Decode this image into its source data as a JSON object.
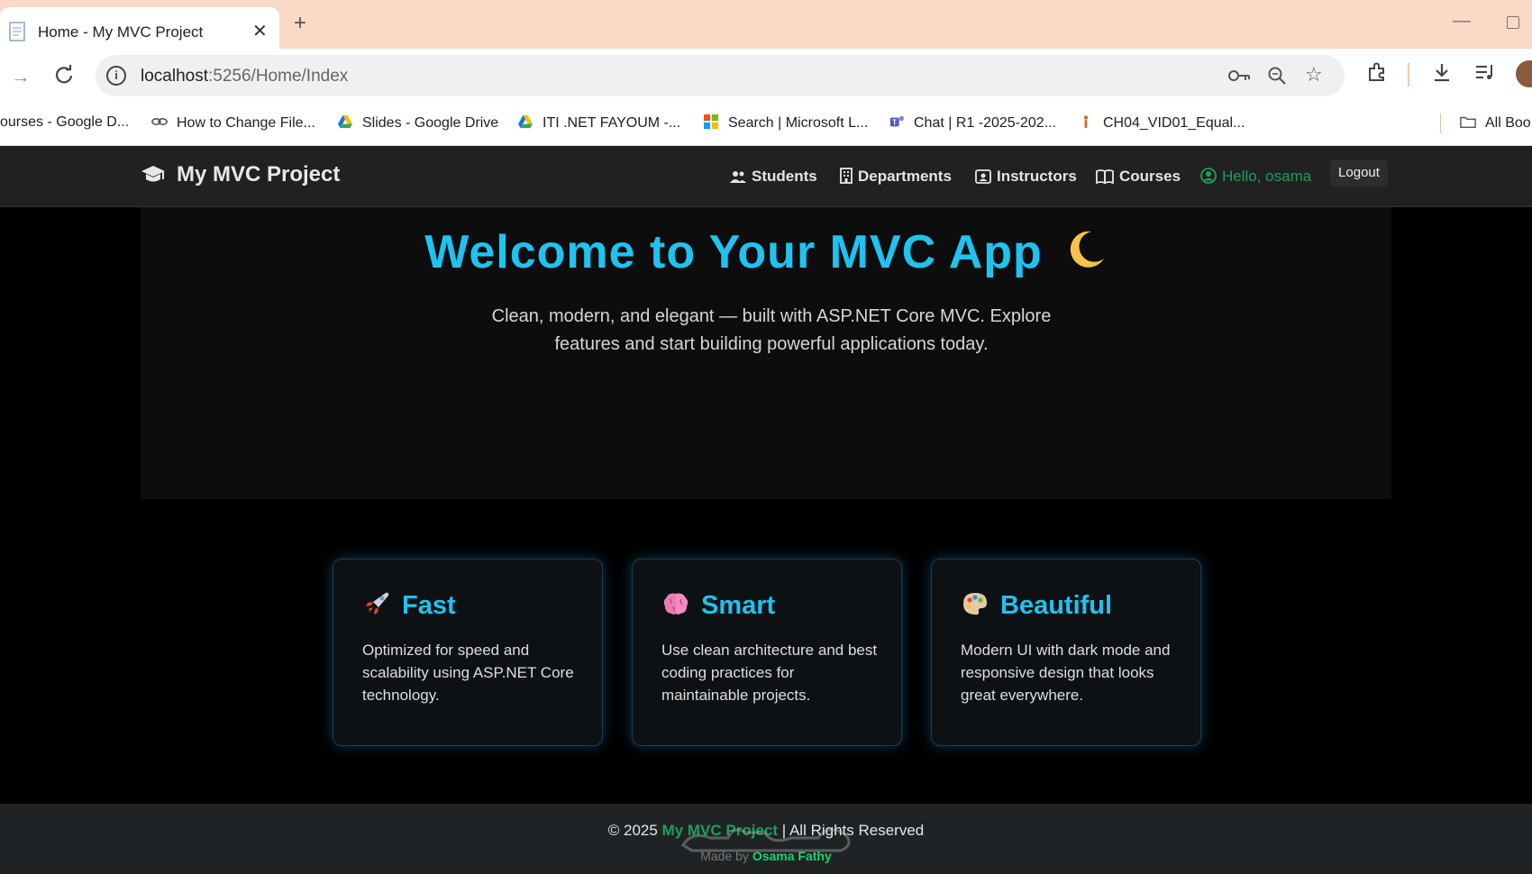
{
  "browser": {
    "tab_title": "Home - My MVC Project",
    "tab_close": "✕",
    "new_tab": "+",
    "url_host": "localhost",
    "url_path": ":5256/Home/Index",
    "bookmarks": [
      "ourses - Google D...",
      "How to Change File...",
      "Slides - Google Drive",
      "ITI .NET FAYOUM -...",
      "Search | Microsoft L...",
      "Chat | R1 -2025-202...",
      "CH04_VID01_Equal...",
      "All Boo"
    ]
  },
  "navbar": {
    "brand": "My MVC Project",
    "items": [
      "Students",
      "Departments",
      "Instructors",
      "Courses"
    ],
    "hello": "Hello, osama",
    "logout": "Logout"
  },
  "hero": {
    "title": "Welcome to Your MVC App",
    "emoji": "🌙",
    "text": "Clean, modern, and elegant — built with ASP.NET Core MVC. Explore features and start building powerful applications today."
  },
  "cards": [
    {
      "title": "Fast",
      "icon": "rocket-icon",
      "text": "Optimized for speed and scalability using ASP.NET Core technology."
    },
    {
      "title": "Smart",
      "icon": "brain-icon",
      "text": "Use clean architecture and best coding practices for maintainable projects."
    },
    {
      "title": "Beautiful",
      "icon": "palette-icon",
      "text": "Modern UI with dark mode and responsive design that looks great everywhere."
    }
  ],
  "footer": {
    "prefix": "© 2025 ",
    "project": "My MVC Project",
    "suffix": " | All Rights Reserved",
    "made_by": "Made by ",
    "author": "Osama Fathy"
  },
  "colors": {
    "accent": "#1ec3f0",
    "hello_green": "#1e9d5e",
    "tabstrip": "#fad9c6"
  }
}
